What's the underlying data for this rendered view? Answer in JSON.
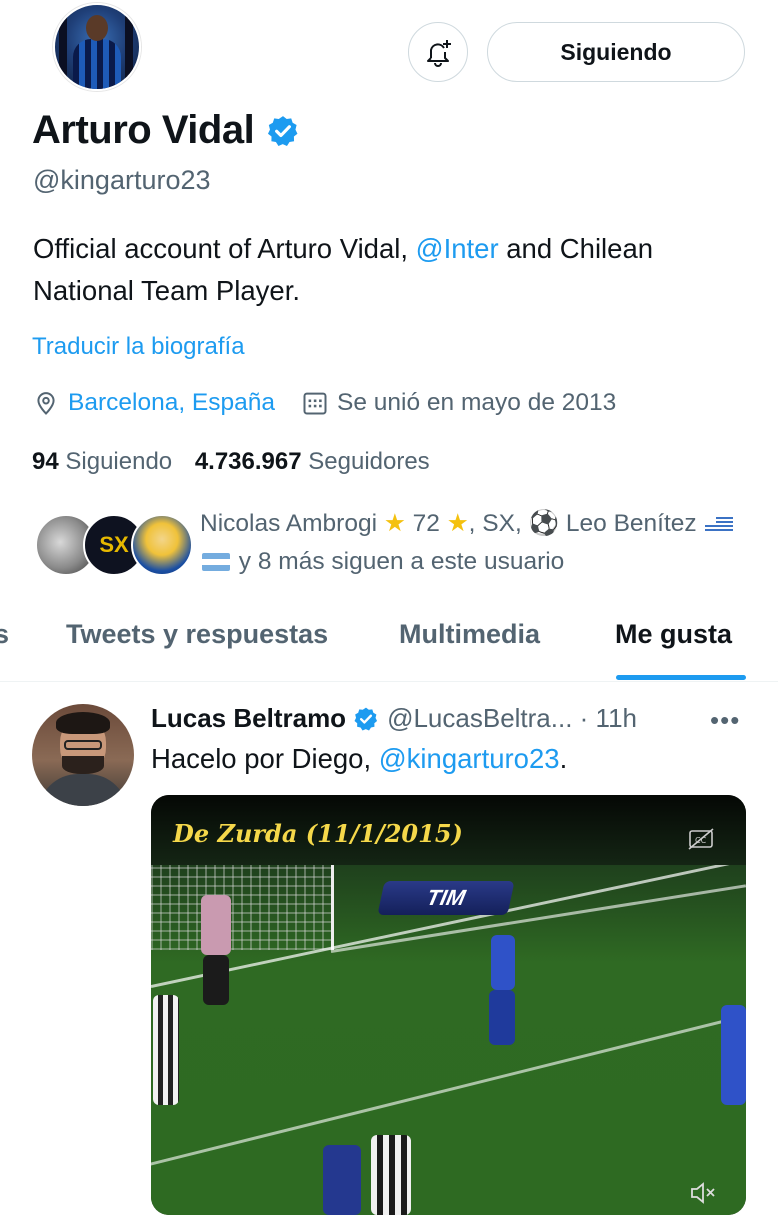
{
  "profile": {
    "name": "Arturo Vidal",
    "handle": "@kingarturo23",
    "bio_pre": "Official account of Arturo Vidal, ",
    "bio_link": "@Inter",
    "bio_post": " and Chilean National Team Player.",
    "translate": "Traducir la biografía",
    "location": "Barcelona, España",
    "joined": "Se unió en mayo de 2013",
    "following_count": "94",
    "following_label": "Siguiendo",
    "followers_count": "4.736.967",
    "followers_label": "Seguidores",
    "followed_by_a": "Nicolas Ambrogi",
    "followed_by_b": "72",
    "followed_by_c": ", SX, ",
    "followed_by_d": " Leo Benítez",
    "followed_by_e": " y 8 más siguen a este usuario"
  },
  "actions": {
    "follow_label": "Siguiendo"
  },
  "tabs": [
    {
      "label": "s"
    },
    {
      "label": "Tweets y respuestas"
    },
    {
      "label": "Multimedia"
    },
    {
      "label": "Me gusta"
    }
  ],
  "tweet": {
    "author": "Lucas Beltramo",
    "meta": "@LucasBeltra... · 11h",
    "text_pre": "Hacelo por Diego, ",
    "text_link": "@kingarturo23",
    "text_post": ".",
    "video_title": "De Zurda (11/1/2015)",
    "ad_text": "TIM"
  },
  "colors": {
    "accent": "#1d9bf0",
    "muted": "#536471",
    "text": "#0f1419"
  },
  "icons": [
    "bell-plus-icon",
    "verified-badge-icon",
    "location-pin-icon",
    "calendar-icon",
    "star-icon",
    "soccer-ball-icon",
    "flag-uruguay-icon",
    "flag-argentina-icon",
    "more-icon",
    "captions-icon",
    "mute-icon"
  ]
}
